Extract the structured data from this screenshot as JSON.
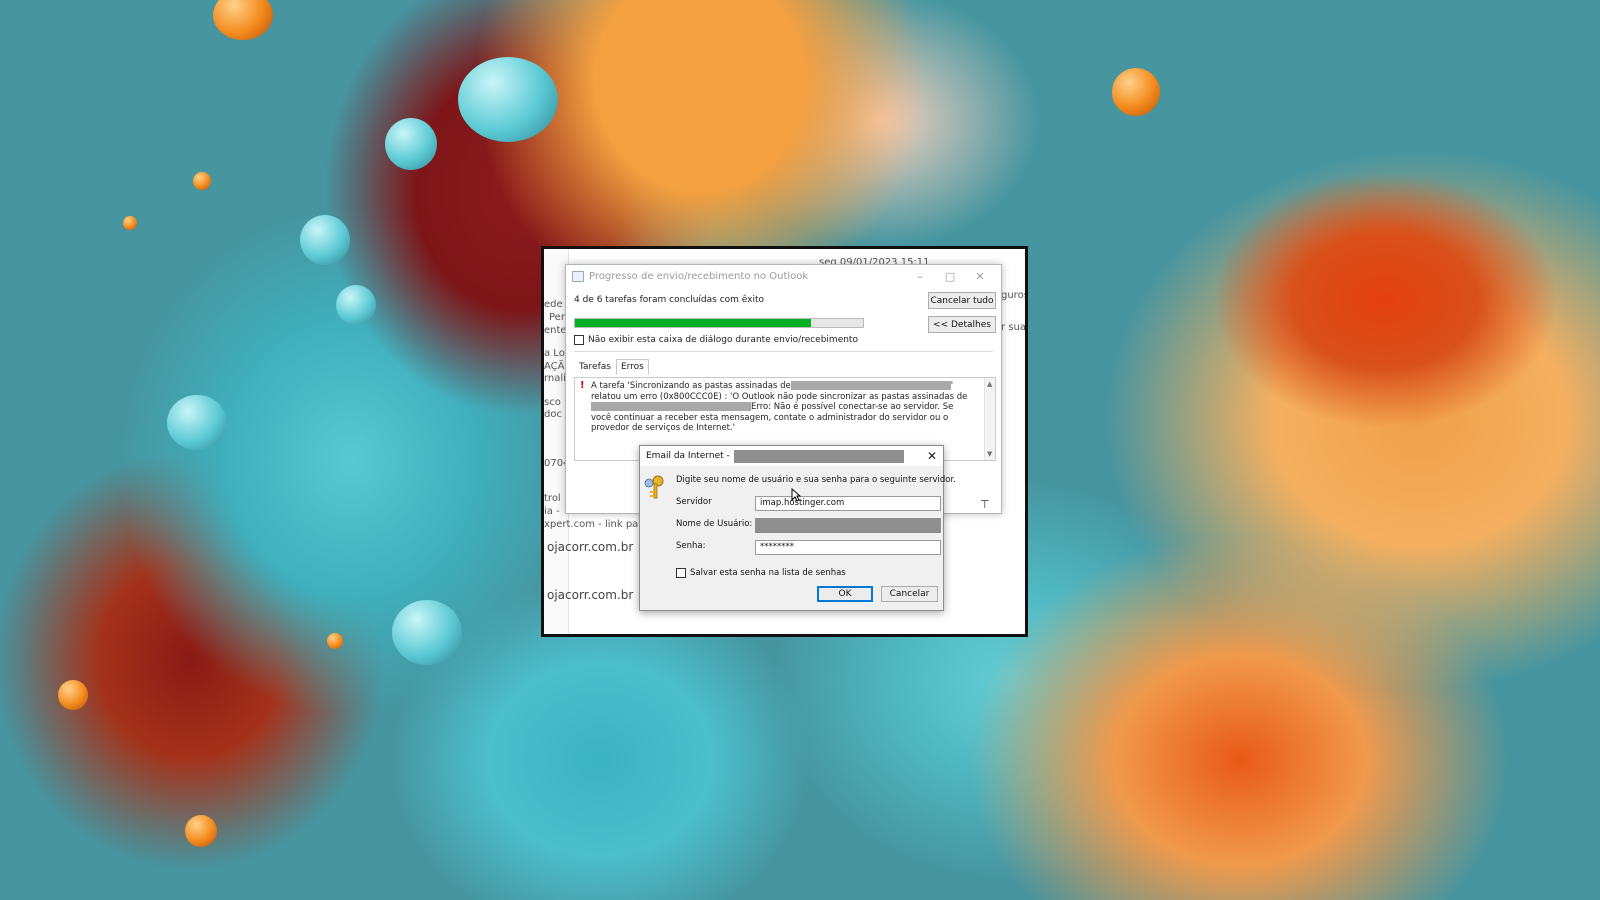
{
  "background": {
    "colors": {
      "teal": "#46959f",
      "orange": "#f3a040",
      "red": "#8c1b1c",
      "cyan": "#58c8d1"
    }
  },
  "outlook_background": {
    "date": "seg 09/01/2023 15:11",
    "snippets_left": [
      "ede",
      "Pen",
      "ente",
      "a Lo",
      "AÇÃ",
      "rnali",
      "sco",
      "doc",
      "0704",
      "trol",
      "ia -",
      "xpert.com - link para",
      "ojacorr.com.br",
      "ojacorr.com.br"
    ],
    "snippets_right": [
      "guros",
      "r sua p"
    ]
  },
  "progress_dialog": {
    "title": "Progresso de envio/recebimento no Outlook",
    "status": "4 de 6 tarefas foram concluídas com êxito",
    "progress_percent": 82,
    "cancel_all_label": "Cancelar tudo",
    "details_label": "<< Detalhes",
    "dont_show_label": "Não exibir esta caixa de diálogo durante envio/recebimento",
    "tabs": [
      "Tarefas",
      "Erros"
    ],
    "active_tab": "Erros",
    "error": {
      "part1": "A tarefa 'Sincronizando as pastas assinadas de",
      "part2": "' relatou um erro (0x800CCC0E) : 'O Outlook não pode sincronizar as pastas assinadas de",
      "part3": "Erro: Não é possível conectar-se ao servidor. Se você continuar a receber esta mensagem, contate o administrador do servidor ou o provedor de serviços de Internet.'"
    }
  },
  "credential_dialog": {
    "title": "Email da Internet -",
    "prompt": "Digite seu nome de usuário e sua senha para o seguinte servidor.",
    "server_label": "Servidor",
    "server_value": "imap.hostinger.com",
    "username_label": "Nome de Usuário:",
    "password_label": "Senha:",
    "password_value": "********",
    "save_password_label": "Salvar esta senha na lista de senhas",
    "ok_label": "OK",
    "cancel_label": "Cancelar"
  }
}
